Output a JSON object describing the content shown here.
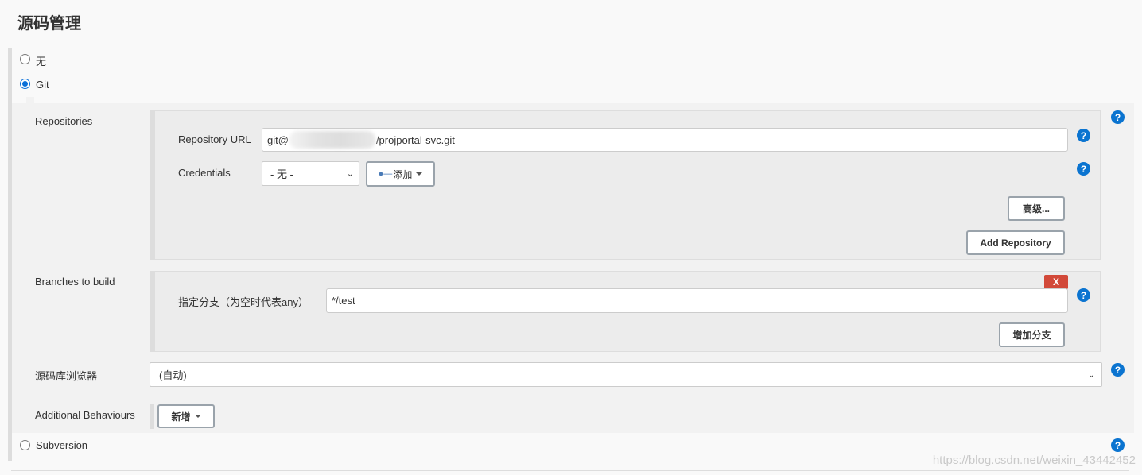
{
  "section_title": "源码管理",
  "scm_options": {
    "none": "无",
    "git": "Git",
    "subversion": "Subversion"
  },
  "git": {
    "repositories_label": "Repositories",
    "repository_url_label": "Repository URL",
    "repository_url_prefix": "git@",
    "repository_url_suffix": "/projportal-svc.git",
    "credentials_label": "Credentials",
    "credentials_value": "- 无 -",
    "add_credentials_label": "添加",
    "advanced_label": "高级...",
    "add_repository_label": "Add Repository",
    "branches_label": "Branches to build",
    "branch_specifier_label": "指定分支（为空时代表any）",
    "branch_specifier_value": "*/test",
    "delete_branch_label": "X",
    "add_branch_label": "增加分支",
    "browser_label": "源码库浏览器",
    "browser_value": "(自动)",
    "additional_behaviours_label": "Additional Behaviours",
    "add_behaviour_label": "新增"
  },
  "help_icon": "?",
  "colors": {
    "accent": "#0b74d0",
    "danger": "#d24939"
  },
  "watermark": "https://blog.csdn.net/weixin_43442452"
}
